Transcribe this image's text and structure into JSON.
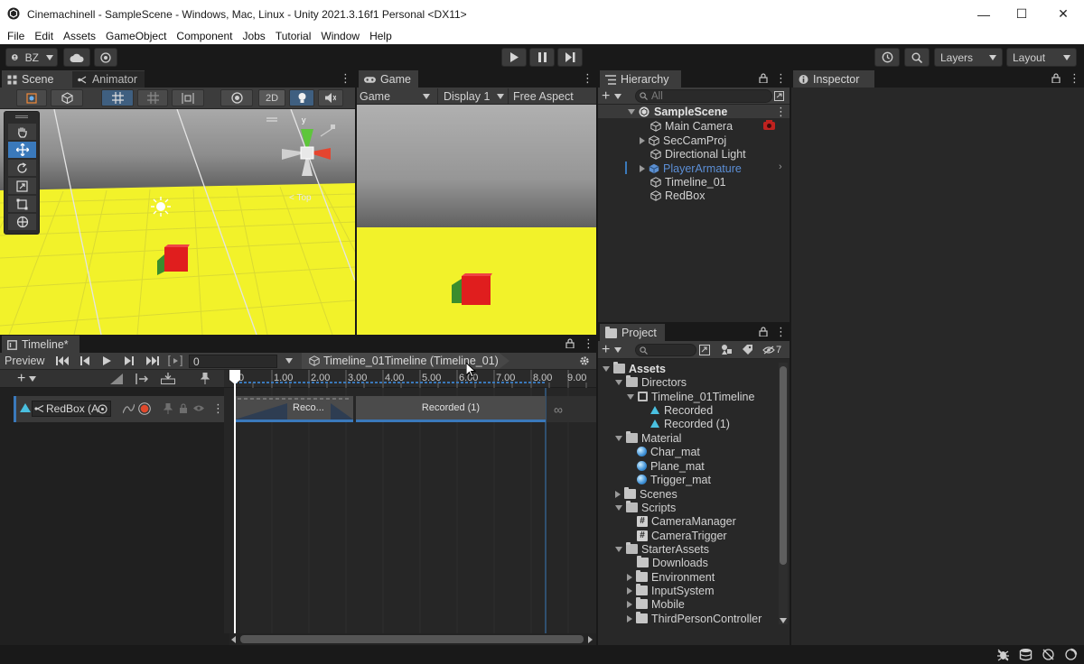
{
  "window": {
    "title": "Cinemachinell - SampleScene - Windows, Mac, Linux - Unity 2021.3.16f1 Personal <DX11>",
    "minimize": "—",
    "maximize": "☐",
    "close": "✕"
  },
  "menu": [
    "File",
    "Edit",
    "Assets",
    "GameObject",
    "Component",
    "Jobs",
    "Tutorial",
    "Window",
    "Help"
  ],
  "toolbar": {
    "account": "BZ",
    "layers": "Layers",
    "layout": "Layout"
  },
  "scene_panel": {
    "tabs": [
      "Scene",
      "Animator"
    ],
    "toggle_2d": "2D",
    "gizmo_axis": "y",
    "gizmo_view": "< Top"
  },
  "game_panel": {
    "tab": "Game",
    "mode": "Game",
    "display": "Display 1",
    "aspect": "Free Aspect"
  },
  "hierarchy": {
    "tab": "Hierarchy",
    "search_placeholder": "All",
    "scene": "SampleScene",
    "items": [
      "Main Camera",
      "SecCamProj",
      "Directional Light",
      "PlayerArmature",
      "Timeline_01",
      "RedBox"
    ]
  },
  "inspector": {
    "tab": "Inspector"
  },
  "project": {
    "tab": "Project",
    "hidden_count": "7",
    "tree": [
      "Assets",
      "Directors",
      "Timeline_01Timeline",
      "Recorded",
      "Recorded (1)",
      "Material",
      "Char_mat",
      "Plane_mat",
      "Trigger_mat",
      "Scenes",
      "Scripts",
      "CameraManager",
      "CameraTrigger",
      "StarterAssets",
      "Downloads",
      "Environment",
      "InputSystem",
      "Mobile",
      "ThirdPersonController"
    ]
  },
  "timeline": {
    "tab": "Timeline*",
    "preview": "Preview",
    "frame": "0",
    "asset": "Timeline_01Timeline (Timeline_01)",
    "ruler": [
      "0",
      "1.00",
      "2.00",
      "3.00",
      "4.00",
      "5.00",
      "6.00",
      "7.00",
      "8.00",
      "9.00"
    ],
    "track_name": "RedBox (A",
    "clip_short": "Reco...",
    "clip_long": "Recorded (1)",
    "infinity": "∞"
  },
  "colors": {
    "accent": "#3a79bb",
    "ground": "#f2f22a",
    "cube": "#e02020",
    "panel": "#282828",
    "tab_active": "#3c3c3c"
  }
}
